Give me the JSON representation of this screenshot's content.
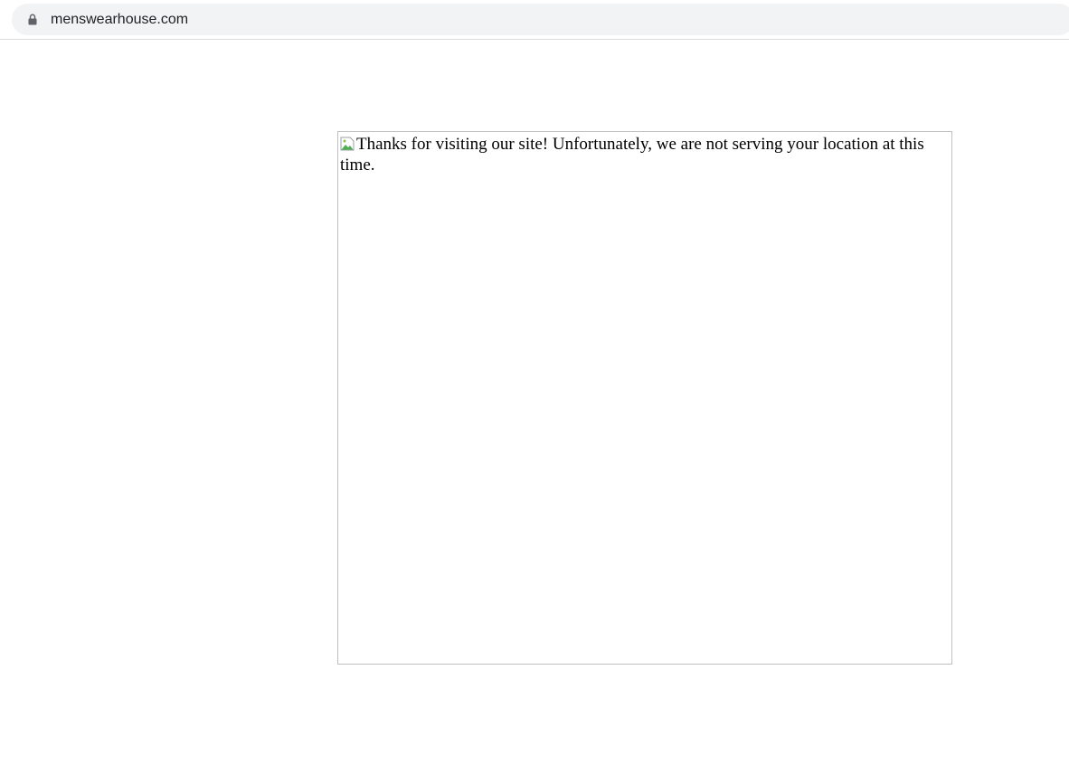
{
  "browser": {
    "url": "menswearhouse.com",
    "secure_icon": "lock-icon"
  },
  "page": {
    "image_alt_text": "Thanks for visiting our site! Unfortunately, we are not serving your location at this time.",
    "broken_image_icon": "broken-image-icon",
    "frame_border_color": "#c0c0c0"
  }
}
